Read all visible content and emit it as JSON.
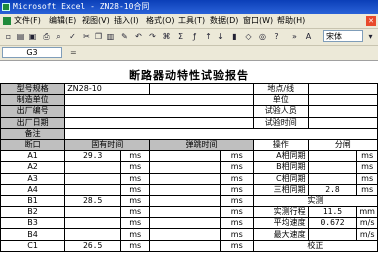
{
  "window": {
    "title": "Microsoft Excel - ZN28-10合同"
  },
  "menu": [
    "文件(F)",
    "编辑(E)",
    "视图(V)",
    "插入(I)",
    "格式(O)",
    "工具(T)",
    "数据(D)",
    "窗口(W)",
    "帮助(H)"
  ],
  "toolbar": {
    "font_name": "宋体"
  },
  "formula_bar": {
    "cell_ref": "G3",
    "fx": "="
  },
  "report": {
    "title": "断路器动特性试验报告",
    "model_label": "型号规格",
    "model_value": "ZN28-10",
    "location_label": "地点/线",
    "manufacturer_label": "制造单位",
    "unit_label": "单位",
    "serial_label": "出厂编号",
    "tester_label": "试验人员",
    "date_label": "出厂日期",
    "test_time_label": "试验时间",
    "remark_label": "备注",
    "fracture_header": "断口",
    "inherent_time_header": "固有时间",
    "bounce_time_header": "弹跳时间",
    "operation_header": "操作",
    "split_header": "分闸",
    "unit_ms": "ms",
    "unit_mm": "mm",
    "unit_ms2": "m/s",
    "rows": [
      {
        "name": "A1",
        "time": "29.3",
        "op": "A相同期"
      },
      {
        "name": "A2",
        "time": "",
        "op": "B相同期"
      },
      {
        "name": "A3",
        "time": "",
        "op": "C相同期"
      },
      {
        "name": "A4",
        "time": "",
        "op": "三相同期",
        "op_value": "2.8"
      },
      {
        "name": "B1",
        "time": "28.5",
        "op": "实测"
      },
      {
        "name": "B2",
        "time": "",
        "op": "实测行程",
        "op_value": "11.5"
      },
      {
        "name": "B3",
        "time": "",
        "op": "平均速度",
        "op_value": "0.672"
      },
      {
        "name": "B4",
        "time": "",
        "op": "最大速度"
      },
      {
        "name": "C1",
        "time": "26.5",
        "op": "校正"
      }
    ]
  }
}
